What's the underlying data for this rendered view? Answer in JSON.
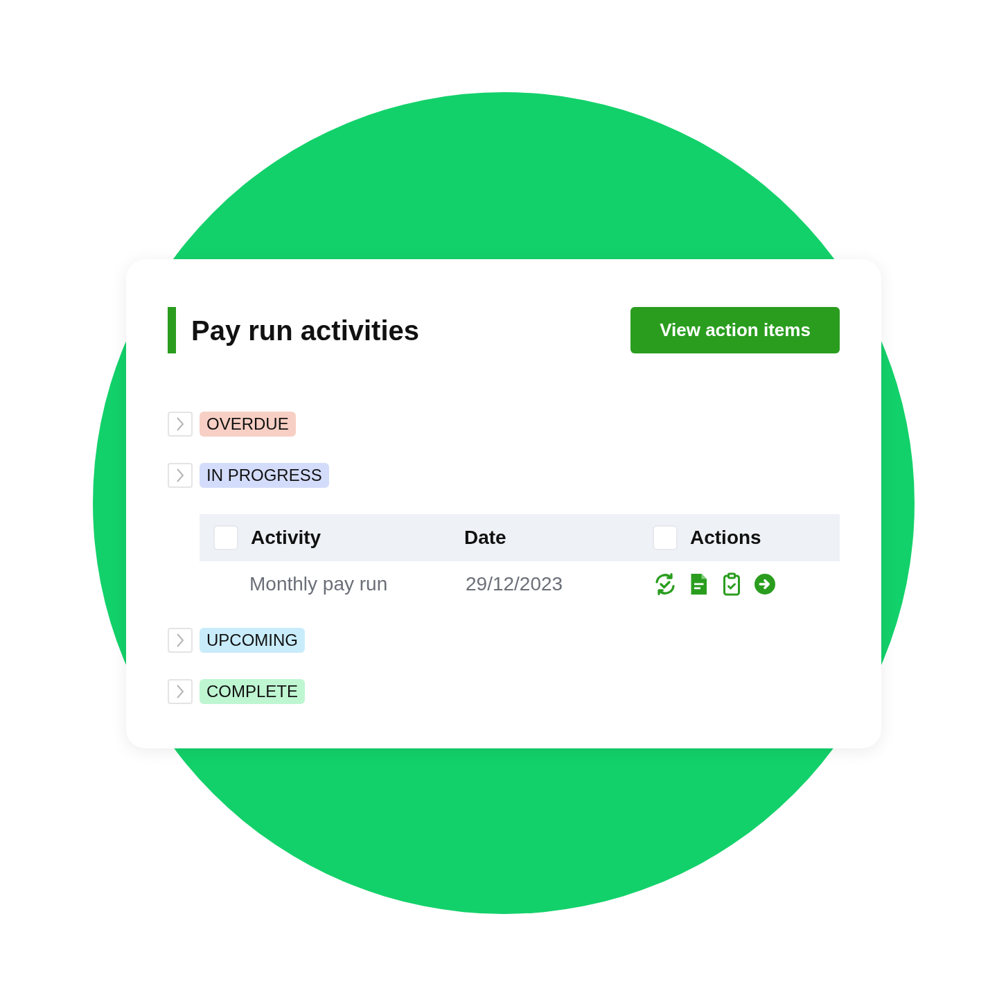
{
  "card": {
    "title": "Pay run activities",
    "button": "View action items"
  },
  "groups": [
    {
      "label": "OVERDUE",
      "color": "#f8cfc4"
    },
    {
      "label": "IN PROGRESS",
      "color": "#d4dcfb",
      "table": {
        "columns": [
          {
            "label": "Activity",
            "checked": false
          },
          {
            "label": "Date"
          },
          {
            "label": "Actions",
            "checked": false
          }
        ],
        "rows": [
          {
            "activity": "Monthly pay run",
            "date": "29/12/2023",
            "actions": [
              {
                "kind": "refresh"
              },
              {
                "kind": "document"
              },
              {
                "kind": "clipboard"
              },
              {
                "kind": "arrow"
              }
            ]
          }
        ]
      }
    },
    {
      "label": "UPCOMING",
      "color": "#c9ecfb"
    },
    {
      "label": "COMPLETE",
      "color": "#bff6d2"
    }
  ]
}
